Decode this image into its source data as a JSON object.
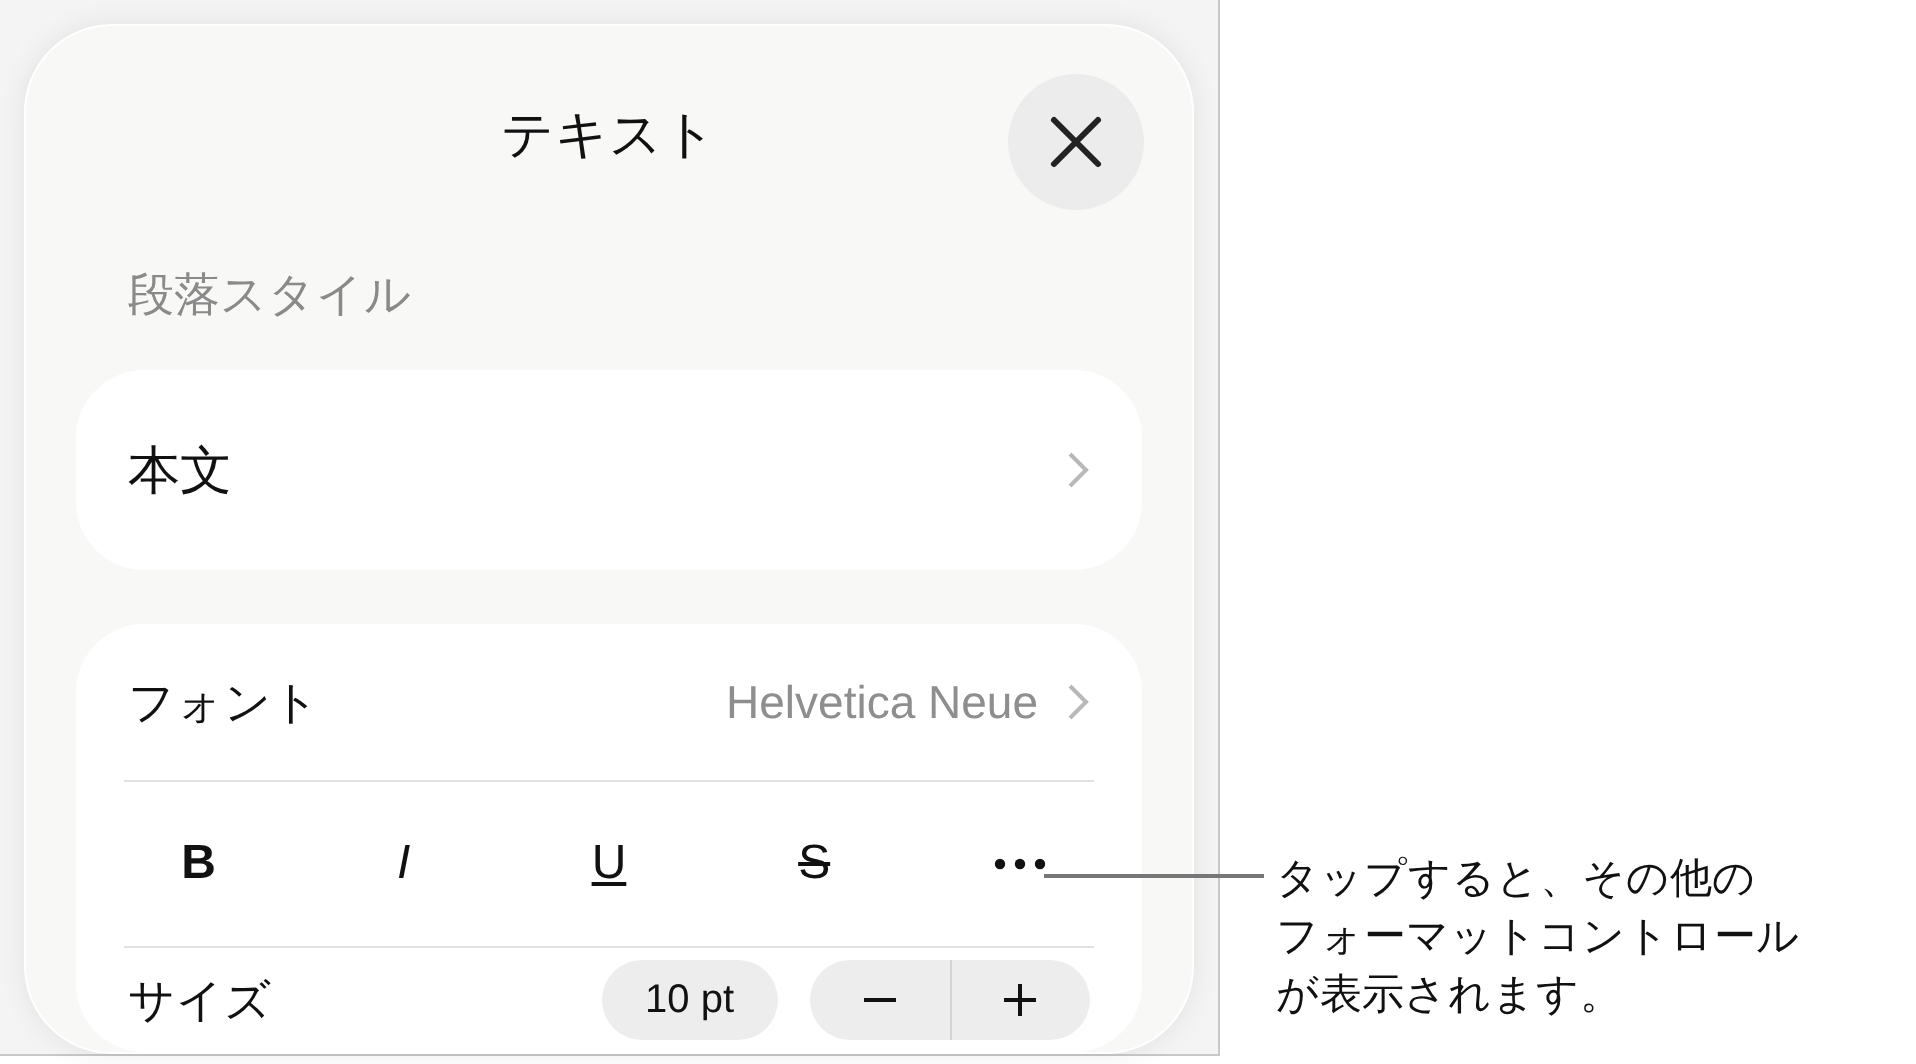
{
  "sheet": {
    "title": "テキスト",
    "paragraph_style_label": "段落スタイル",
    "paragraph_style": "本文",
    "font": {
      "label": "フォント",
      "value": "Helvetica Neue"
    },
    "format_buttons": [
      {
        "kind": "bold",
        "label": "B"
      },
      {
        "kind": "italic",
        "label": "I"
      },
      {
        "kind": "underline",
        "label": "U"
      },
      {
        "kind": "strike",
        "label": "S"
      },
      {
        "kind": "more"
      }
    ],
    "size": {
      "label": "サイズ",
      "value": "10 pt"
    }
  },
  "callout_lines": [
    "タップすると、その他の",
    "フォーマットコントロール",
    "が表示されます。"
  ]
}
